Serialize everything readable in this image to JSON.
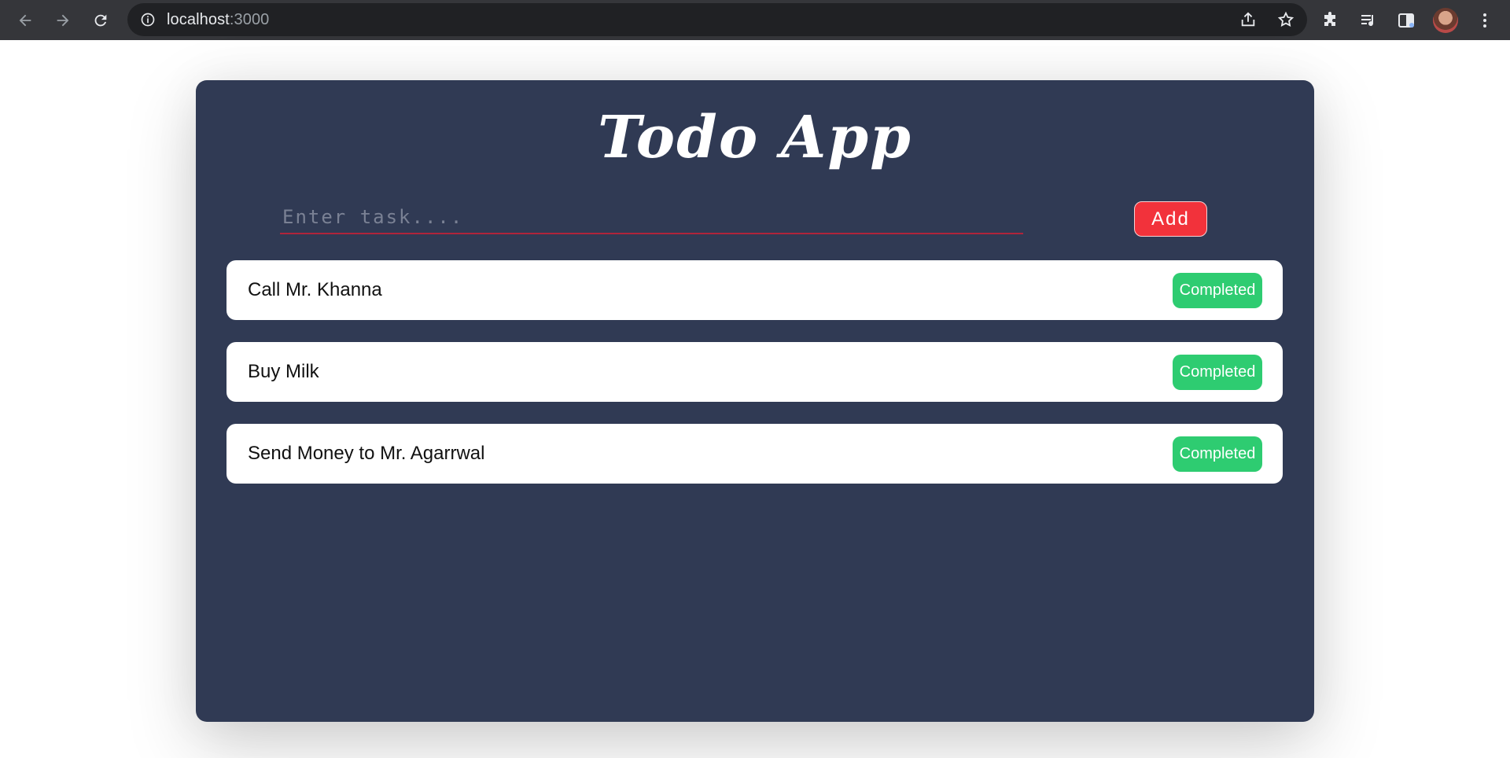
{
  "browser": {
    "url_host": "localhost",
    "url_port": ":3000"
  },
  "app": {
    "title": "Todo App",
    "input_placeholder": "Enter task....",
    "add_label": "Add",
    "tasks": [
      {
        "text": "Call Mr. Khanna",
        "status": "Completed"
      },
      {
        "text": "Buy Milk",
        "status": "Completed"
      },
      {
        "text": "Send Money to Mr. Agarrwal",
        "status": "Completed"
      }
    ]
  },
  "colors": {
    "card_bg": "#303a54",
    "add_button": "#f2323b",
    "status_button": "#2ecc71"
  }
}
